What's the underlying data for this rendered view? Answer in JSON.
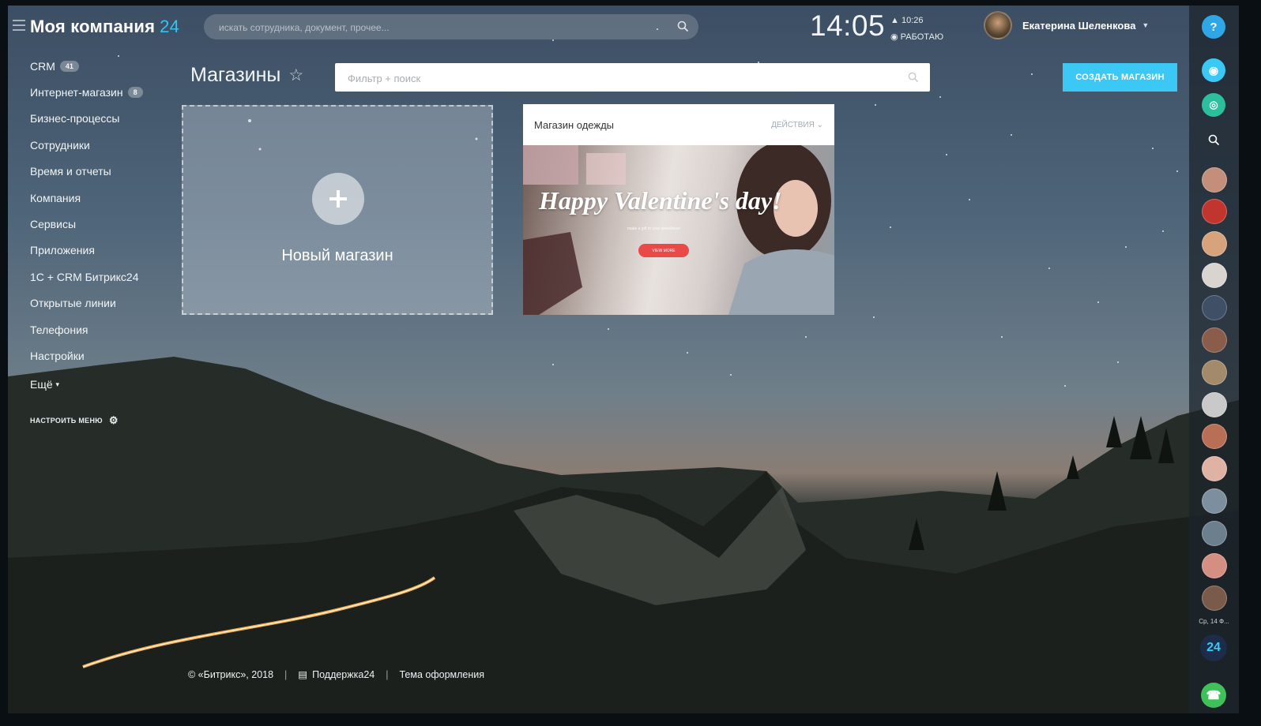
{
  "header": {
    "logo_text": "Моя компания",
    "logo_suffix": "24",
    "search_placeholder": "искать сотрудника, документ, прочее...",
    "clock": "14:05",
    "work_time": "10:26",
    "work_status": "РАБОТАЮ",
    "user_name": "Екатерина Шеленкова"
  },
  "sidebar": {
    "items": [
      {
        "label": "CRM",
        "badge": "41"
      },
      {
        "label": "Интернет-магазин",
        "badge": "8"
      },
      {
        "label": "Бизнес-процессы"
      },
      {
        "label": "Сотрудники"
      },
      {
        "label": "Время и отчеты"
      },
      {
        "label": "Компания"
      },
      {
        "label": "Сервисы"
      },
      {
        "label": "Приложения"
      },
      {
        "label": "1С + CRM Битрикс24"
      },
      {
        "label": "Открытые линии"
      },
      {
        "label": "Телефония"
      },
      {
        "label": "Настройки"
      }
    ],
    "more_label": "Ещё",
    "configure_label": "НАСТРОИТЬ МЕНЮ"
  },
  "main": {
    "title": "Магазины",
    "filter_placeholder": "Фильтр + поиск",
    "create_button": "СОЗДАТЬ МАГАЗИН",
    "new_shop_label": "Новый магазин",
    "shop_card": {
      "name": "Магазин одежды",
      "actions_label": "ДЕЙСТВИЯ",
      "banner_title": "Happy Valentine's day!",
      "banner_subtitle": "make a gift to your sweetheart",
      "banner_button": "VIEW MORE"
    }
  },
  "footer": {
    "copyright": "© «Битрикс», 2018",
    "support": "Поддержка24",
    "theme": "Тема оформления"
  },
  "right_bar": {
    "help": "?",
    "date_label": "Ср, 14 Ф...",
    "app_badge": "24"
  },
  "colors": {
    "accent": "#3bc8f5",
    "logo_accent": "#2fc6f6",
    "banner_button": "#e94a47",
    "call_button": "#3fc05a"
  }
}
